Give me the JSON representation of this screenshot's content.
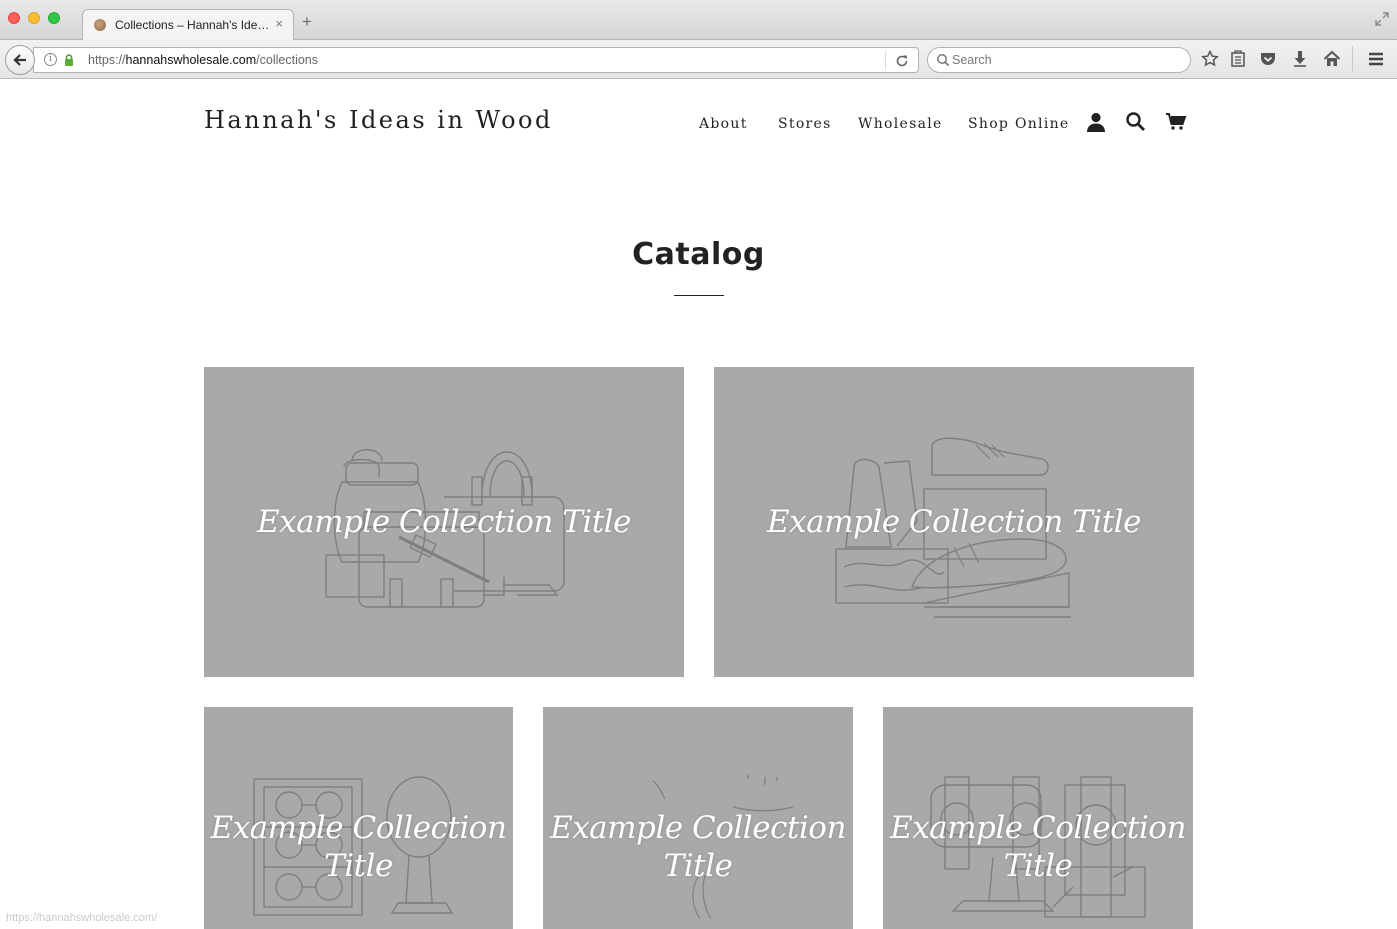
{
  "browser": {
    "tab_title": "Collections – Hannah's Ide…",
    "tab_close": "×",
    "new_tab": "+",
    "url_prefix": "https://",
    "url_host": "hannahswholesale.com",
    "url_path": "/collections",
    "search_placeholder": "Search",
    "status_url": "https://hannahswholesale.com/"
  },
  "header": {
    "logo": "Hannah's Ideas in Wood",
    "nav": [
      "About",
      "Stores",
      "Wholesale",
      "Shop Online"
    ],
    "icons": [
      "account-icon",
      "search-icon",
      "cart-icon"
    ]
  },
  "main": {
    "title": "Catalog",
    "collections": [
      {
        "title": "Example Collection Title",
        "art": "bags"
      },
      {
        "title": "Example Collection Title",
        "art": "shoes"
      },
      {
        "title": "Example Collection Title",
        "art": "glasses"
      },
      {
        "title": "Example Collection Title",
        "art": "lamp"
      },
      {
        "title": "Example Collection Title",
        "art": "watches"
      }
    ]
  },
  "colors": {
    "card_bg": "#a8a9a8",
    "line_art": "#7e7f7e",
    "text": "#222222"
  }
}
